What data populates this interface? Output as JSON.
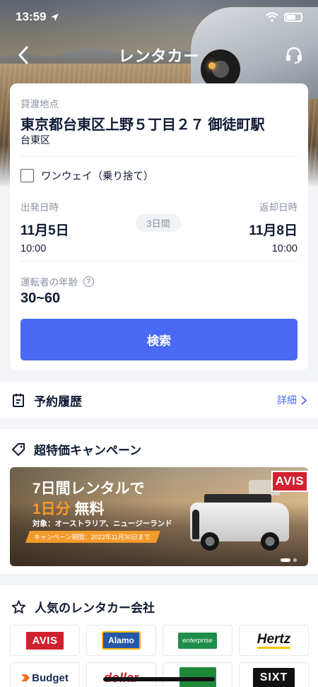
{
  "status_bar": {
    "time": "13:59"
  },
  "nav": {
    "title": "レンタカー"
  },
  "search_card": {
    "pickup_label": "貸渡地点",
    "pickup_location": "東京都台東区上野５丁目２７ 御徒町駅",
    "pickup_area": "台東区",
    "one_way_label": "ワンウェイ（乗り捨て）",
    "one_way_checked": false,
    "departure_label": "出発日時",
    "departure_date": "11月5日",
    "departure_time": "10:00",
    "duration": "3日間",
    "return_label": "返却日時",
    "return_date": "11月8日",
    "return_time": "10:00",
    "driver_age_label": "運転者の年齢",
    "driver_age_value": "30~60",
    "search_button": "検索"
  },
  "history": {
    "title": "予約履歴",
    "link": "詳細"
  },
  "campaign": {
    "title": "超特価キャンペーン",
    "banner": {
      "line1": "7日間レンタルで",
      "line2_highlight": "1日分",
      "line2_rest": "無料",
      "target": "対象：オーストラリア、ニュージーランド",
      "period": "キャンペーン期間：2022年11月30日まで",
      "brand": "AVIS"
    }
  },
  "companies": {
    "title": "人気のレンタカー会社",
    "logos": {
      "avis": "AVIS",
      "alamo": "Alamo",
      "enterprise": "enterprise",
      "hertz": "Hertz",
      "budget": "Budget",
      "dollar": "dollar",
      "sixt": "SIXT"
    }
  },
  "colors": {
    "primary": "#4a69f5",
    "highlight": "#f39a2a",
    "avis_red": "#d2202f"
  }
}
